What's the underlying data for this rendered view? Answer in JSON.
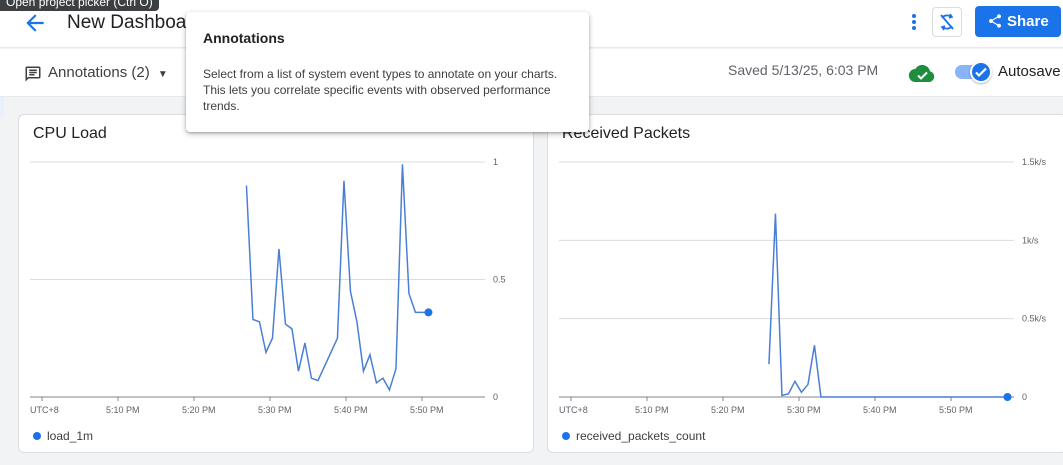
{
  "header": {
    "tooltip": "Open project picker (Ctrl O)",
    "title": "New Dashboard",
    "share_label": "Share"
  },
  "toolbar": {
    "annotations_label": "Annotations (2)",
    "saved_text": "Saved 5/13/25, 6:03 PM",
    "autosave_label": "Autosave",
    "autosave_on": true
  },
  "popover": {
    "title": "Annotations",
    "body": "Select from a list of system event types to annotate on your charts. This lets you correlate specific events with observed performance trends."
  },
  "colors": {
    "accent": "#1a73e8",
    "cloud": "#1e8e3e"
  },
  "chart_data": [
    {
      "type": "line",
      "title": "CPU Load",
      "x_ticks": [
        "UTC+8",
        "5:10 PM",
        "5:20 PM",
        "5:30 PM",
        "5:40 PM",
        "5:50 PM"
      ],
      "y_ticks": [
        "1",
        "0.5",
        "0"
      ],
      "ylim": [
        0,
        1
      ],
      "x_range_minutes": [
        0,
        70
      ],
      "series": [
        {
          "name": "load_1m",
          "x": [
            33.3,
            34.3,
            35.3,
            36.3,
            37.3,
            38.3,
            39.3,
            40.3,
            41.3,
            42.3,
            43.3,
            44.3,
            47.3,
            48.3,
            49.3,
            50.3,
            51.3,
            52.3,
            53.3,
            54.3,
            55.3,
            56.3,
            57.3,
            58.3,
            59.3,
            60.3,
            61.3
          ],
          "values": [
            0.9,
            0.33,
            0.32,
            0.19,
            0.25,
            0.63,
            0.31,
            0.29,
            0.11,
            0.23,
            0.08,
            0.07,
            0.25,
            0.92,
            0.45,
            0.32,
            0.11,
            0.18,
            0.06,
            0.08,
            0.03,
            0.12,
            0.99,
            0.44,
            0.36,
            0.36,
            0.36
          ]
        }
      ],
      "grid": true,
      "legend": "bottom-left"
    },
    {
      "type": "line",
      "title": "Received Packets",
      "x_ticks": [
        "UTC+8",
        "5:10 PM",
        "5:20 PM",
        "5:30 PM",
        "5:40 PM",
        "5:50 PM"
      ],
      "y_ticks": [
        "1.5k/s",
        "1k/s",
        "0.5k/s",
        "0"
      ],
      "ylim": [
        0,
        1.5
      ],
      "x_range_minutes": [
        0,
        70
      ],
      "series": [
        {
          "name": "received_packets_count",
          "x": [
            32.3,
            33.3,
            34.3,
            35.3,
            36.3,
            37.3,
            38.3,
            39.3,
            40.3,
            45,
            50,
            55,
            60,
            65,
            69
          ],
          "values": [
            0.21,
            1.17,
            0.01,
            0.02,
            0.1,
            0.03,
            0.08,
            0.33,
            0.0,
            0.0,
            0.0,
            0.0,
            0.0,
            0.0,
            0.0
          ]
        }
      ],
      "grid": true,
      "legend": "bottom-left"
    }
  ]
}
